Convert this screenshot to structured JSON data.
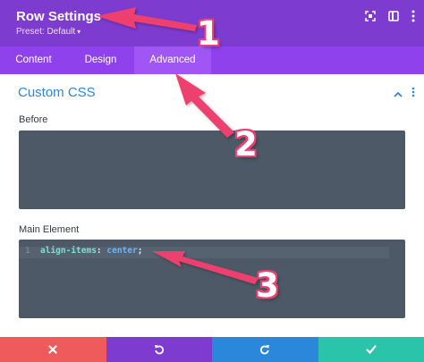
{
  "header": {
    "title": "Row Settings",
    "preset": "Preset: Default",
    "icons": [
      "expand-icon",
      "sidebar-split-icon",
      "more-vertical-icon"
    ]
  },
  "tabs": [
    {
      "label": "Content",
      "active": false
    },
    {
      "label": "Design",
      "active": false
    },
    {
      "label": "Advanced",
      "active": true
    }
  ],
  "section": {
    "title": "Custom CSS",
    "fields": [
      {
        "label": "Before",
        "lines": []
      },
      {
        "label": "Main Element",
        "lines": [
          {
            "number": "1",
            "property": "align-items",
            "separator": ": ",
            "value": "center",
            "terminator": ";"
          }
        ]
      }
    ]
  },
  "annotations": [
    "1",
    "2",
    "3"
  ],
  "actions": [
    {
      "icon": "close-icon",
      "color": "#ef5b5b"
    },
    {
      "icon": "undo-icon",
      "color": "#7e3bd0"
    },
    {
      "icon": "redo-icon",
      "color": "#2b87da"
    },
    {
      "icon": "check-icon",
      "color": "#29c4a9"
    }
  ],
  "colors": {
    "header": "#7e3bd0",
    "tabs": "#8f42ec",
    "tab_active": "#a056f5",
    "accent_blue": "#2b87da",
    "code_bg": "#4d5966",
    "annotation": "#ee3f6e"
  }
}
